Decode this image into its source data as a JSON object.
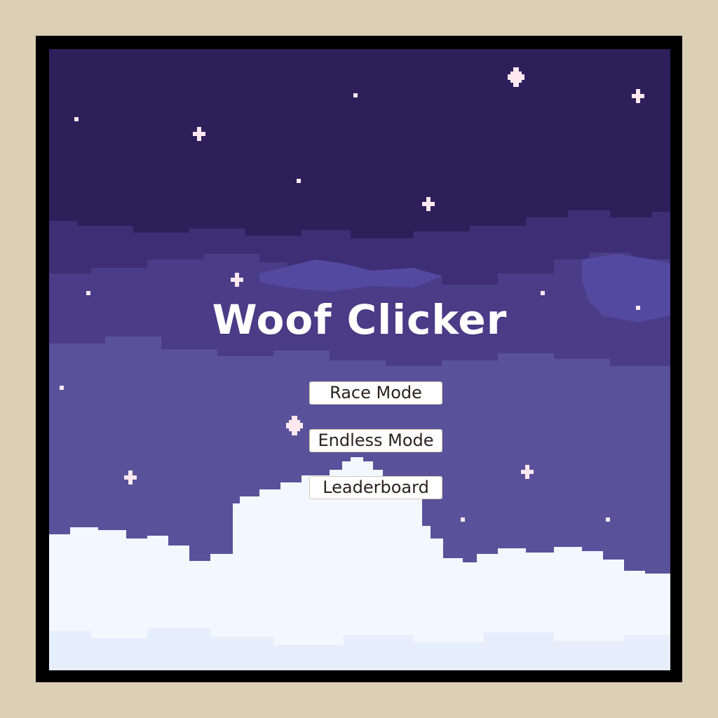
{
  "game": {
    "title": "Woof Clicker",
    "menu": {
      "race_mode_label": "Race Mode",
      "endless_mode_label": "Endless Mode",
      "leaderboard_label": "Leaderboard"
    }
  },
  "theme": {
    "backdrop": "#dbcfb5",
    "frame": "#000000",
    "sky_top": "#2d1f5a",
    "cloud_band_dark": "#3f2f78",
    "cloud_band_mid": "#4c3f8a",
    "sky_lower": "#5a5399",
    "cloud_white": "#f4f8ff",
    "star": "#ffe8ef"
  }
}
